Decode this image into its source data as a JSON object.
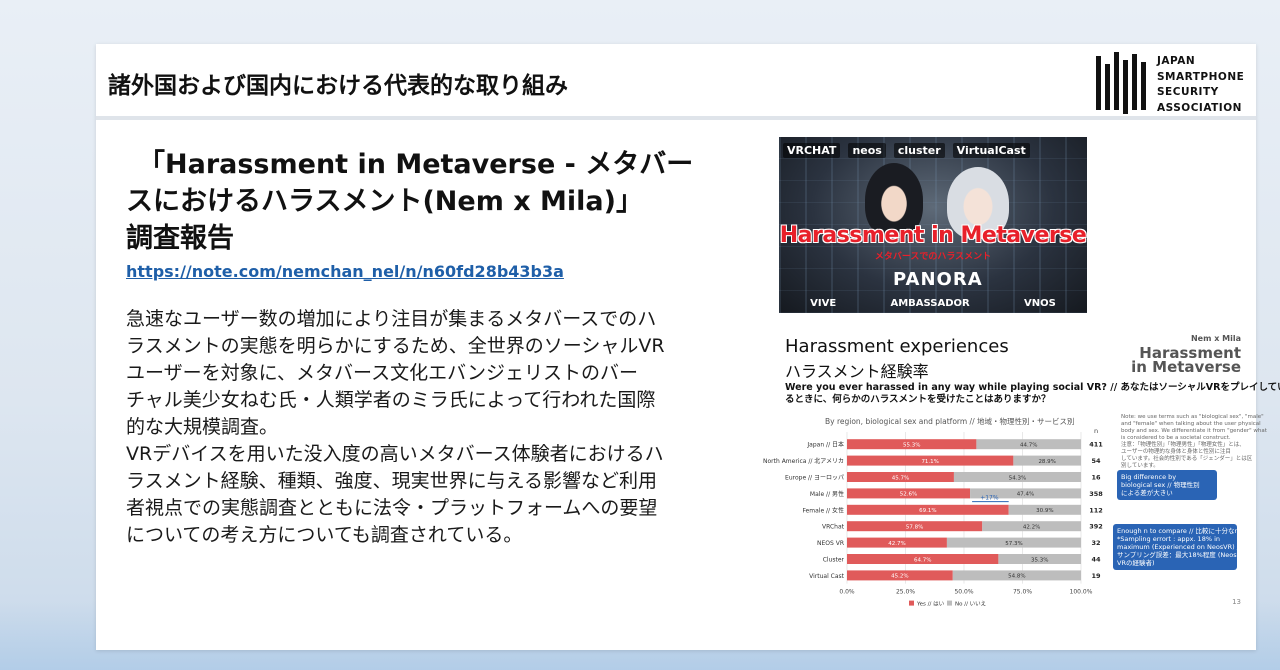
{
  "header": {
    "title": "諸外国および国内における代表的な取り組み",
    "logo_lines": [
      "JAPAN",
      "SMARTPHONE",
      "SECURITY",
      "ASSOCIATION"
    ]
  },
  "main": {
    "report_title_lines": [
      "「Harassment in Metaverse - メタバー",
      "スにおけるハラスメント(Nem x Mila)」",
      "調査報告"
    ],
    "link": "https://note.com/nemchan_nel/n/n60fd28b43b3a",
    "description_lines": [
      "急速なユーザー数の増加により注目が集まるメタバースでのハ",
      "ラスメントの実態を明らかにするため、全世界のソーシャルVR",
      "ユーザーを対象に、メタバース文化エバンジェリストのバー",
      "チャル美少女ねむ氏・人類学者のミラ氏によって行われた国際",
      "的な大規模調査。",
      "VRデバイスを用いた没入度の高いメタバース体験者におけるハ",
      "ラスメント経験、種類、強度、現実世界に与える影響など利用",
      "者視点での実態調査とともに法令・プラットフォームへの要望",
      "についての考え方についても調査されている。"
    ]
  },
  "banner": {
    "logos": [
      "VRCHAT",
      "neos",
      "cluster",
      "VirtualCast"
    ],
    "title": "Harassment in Metaverse",
    "subtitle": "メタバースでのハラスメント",
    "panora": "PANORA",
    "sponsors": [
      "VIVE",
      "AMBASSADOR",
      "VNOS"
    ]
  },
  "chart_data": {
    "type": "bar",
    "stacked": true,
    "orientation": "horizontal",
    "title": "Harassment experiences",
    "title_ja": "ハラスメント経験率",
    "brand": [
      "Nem x Mila",
      "Harassment",
      "in Metaverse"
    ],
    "question_lines": [
      "Were you ever harassed in any way while playing social VR? // あなたはソーシャルVRをプレイしてい",
      "るときに、何らかのハラスメントを受けたことはありますか？"
    ],
    "subtitle": "By region, biological sex and platform // 地域・物理性別・サービス別",
    "categories": [
      "Japan // 日本",
      "North America // 北アメリカ",
      "Europe // ヨーロッパ",
      "Male // 男性",
      "Female // 女性",
      "VRChat",
      "NEOS VR",
      "Cluster",
      "Virtual Cast"
    ],
    "series": [
      {
        "name": "Yes // はい",
        "color": "#e05a5a",
        "values": [
          55.3,
          71.1,
          45.7,
          52.6,
          69.1,
          57.8,
          42.7,
          64.7,
          45.2
        ]
      },
      {
        "name": "No // いいえ",
        "color": "#bdbdbd",
        "values": [
          44.7,
          28.9,
          54.3,
          47.4,
          30.9,
          42.2,
          57.3,
          35.3,
          54.8
        ]
      }
    ],
    "yes_labels": [
      "55.3%",
      "71.1%",
      "45.7%",
      "52.6%",
      "69.1%",
      "57.8%",
      "42.7%",
      "64.7%",
      "45.2%"
    ],
    "no_labels": [
      "44.7%",
      "28.9%",
      "54.3%",
      "47.4%",
      "30.9%",
      "42.2%",
      "57.3%",
      "35.3%",
      "54.8%"
    ],
    "n_header": "n",
    "n_values": [
      "411",
      "54",
      "16",
      "358",
      "112",
      "392",
      "32",
      "44",
      "19"
    ],
    "x_ticks": [
      "0.0%",
      "25.0%",
      "50.0%",
      "75.0%",
      "100.0%"
    ],
    "xlim": [
      0,
      100
    ],
    "annotation_diff": "+17%",
    "callout_1": [
      "Big difference by",
      "biological sex // 物理性別",
      "による差が大きい"
    ],
    "callout_2": [
      "Enough n to compare // 比較に十分なn数",
      "*Sampling errort : appx. 18% in",
      "maximum (Experienced on NeosVR) //",
      "サンプリング誤差：最大18%程度 (Neos",
      "VRの経験者)"
    ],
    "note_lines": [
      "Note: we use terms such as \"biological sex\", \"male\"",
      "and \"female\" when talking about the user physical",
      "body and sex. We differentiate it from \"gender\" what",
      "is considered to be a societal construct.",
      "注意：「物理性別」「物理男性」「物理女性」とは、",
      "ユーザーの物理的な身体と身体と性別に注目",
      "しています。社会的性別である「ジェンダー」とは区",
      "別しています。"
    ],
    "legend_placement": "bottom",
    "page": "13"
  }
}
